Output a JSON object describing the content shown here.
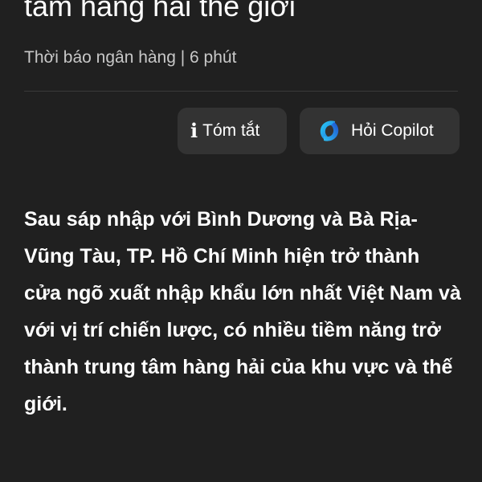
{
  "article": {
    "title_tail": "tâm hàng hải thế giới",
    "meta": "Thời báo ngân hàng | 6 phút",
    "body": "Sau sáp nhập với Bình Dương và Bà Rịa-Vũng Tàu, TP. Hồ Chí Minh hiện trở thành cửa ngõ xuất nhập khẩu lớn nhất Việt Nam và với vị trí chiến lược, có nhiều tiềm năng trở thành trung tâm hàng hải của khu vực và thế giới."
  },
  "actions": {
    "summary_label": "Tóm tắt",
    "summary_icon": "info-icon",
    "copilot_label": "Hỏi Copilot",
    "copilot_icon": "copilot-icon"
  },
  "colors": {
    "background": "#202020",
    "button_bg": "#333333",
    "text": "#ffffff",
    "meta_text": "#c8c8c8"
  }
}
